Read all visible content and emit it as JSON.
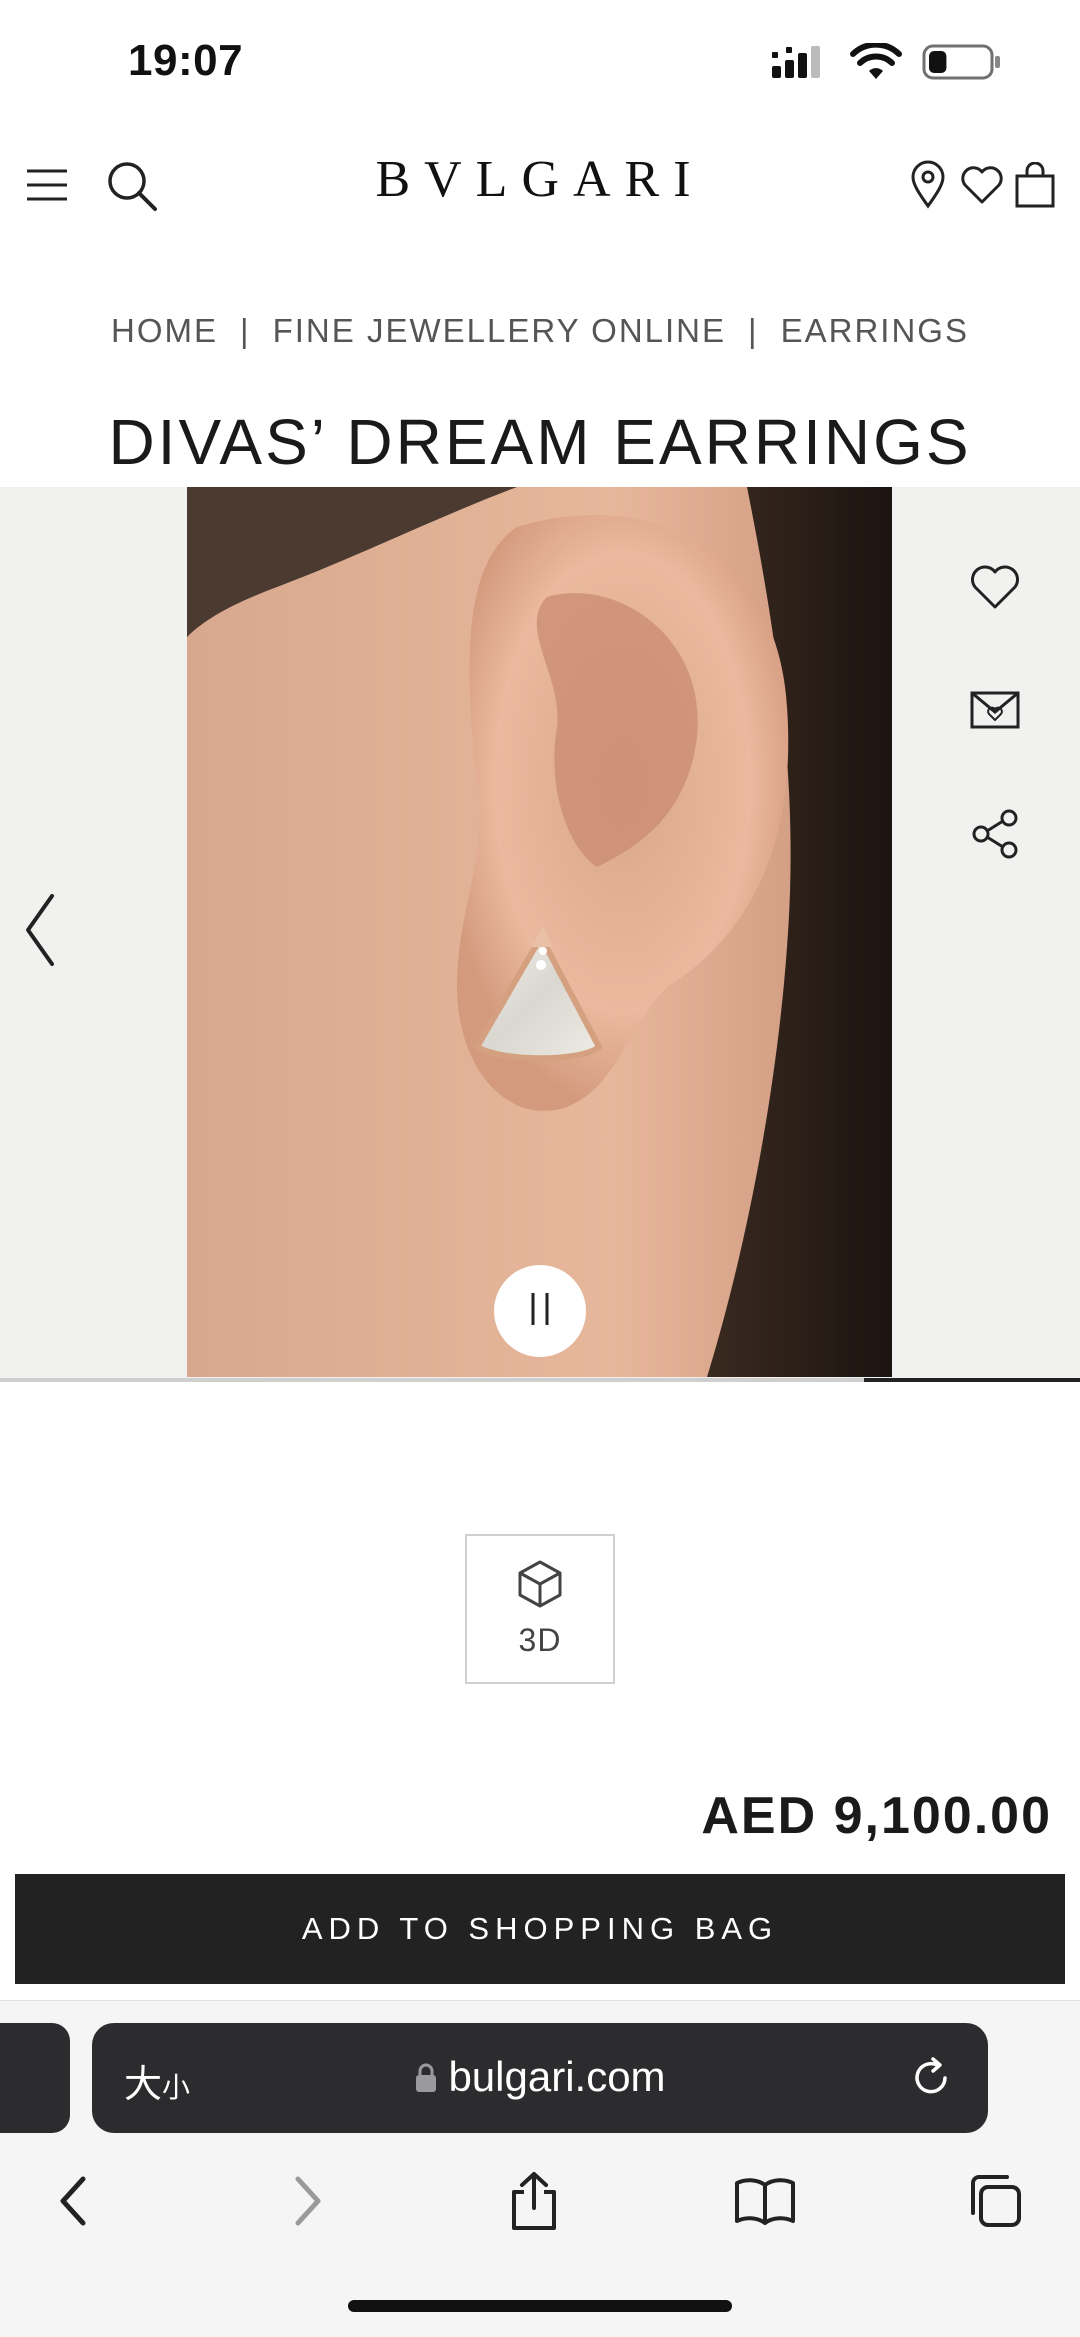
{
  "status_bar": {
    "time": "19:07",
    "battery_level": 0.3
  },
  "header": {
    "brand": "BVLGARI"
  },
  "breadcrumb": {
    "items": [
      "HOME",
      "FINE JEWELLERY ONLINE",
      "EARRINGS"
    ],
    "separator": "|"
  },
  "product": {
    "title": "DIVAS’ DREAM EARRINGS",
    "price": "AED 9,100.00",
    "view_3d_label": "3D",
    "add_to_bag_label": "ADD TO SHOPPING BAG"
  },
  "gallery": {
    "progress": 0.8
  },
  "browser": {
    "text_size_label": "大",
    "text_size_small": "小",
    "url": "bulgari.com"
  },
  "colors": {
    "dark": "#222222",
    "gallery_bg": "#f1f1f0",
    "url_bar": "#2c2c2e"
  },
  "icons": [
    "menu-icon",
    "search-icon",
    "location-icon",
    "heart-icon",
    "bag-icon",
    "wishlist-icon",
    "envelope-heart-icon",
    "share-icon",
    "chevron-left-icon",
    "pause-icon",
    "cube-icon",
    "lock-icon",
    "reload-icon",
    "back-icon",
    "forward-icon",
    "share-icon",
    "bookmarks-icon",
    "tabs-icon"
  ]
}
